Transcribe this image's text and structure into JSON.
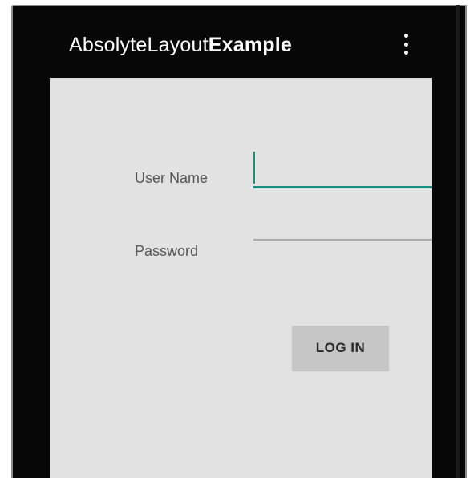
{
  "app": {
    "title_regular": "AbsolyteLayout",
    "title_bold": "Example",
    "overflow_icon": "more-vert-icon"
  },
  "form": {
    "username_label": "User Name",
    "username_value": "",
    "password_label": "Password",
    "password_value": "",
    "login_label": "LOG IN"
  },
  "colors": {
    "app_bar": "#070707",
    "content_background": "#e2e2e2",
    "focused_underline": "#1b8e7c",
    "unfocused_underline": "#a9a9a9",
    "button_background": "#c6c6c6"
  }
}
